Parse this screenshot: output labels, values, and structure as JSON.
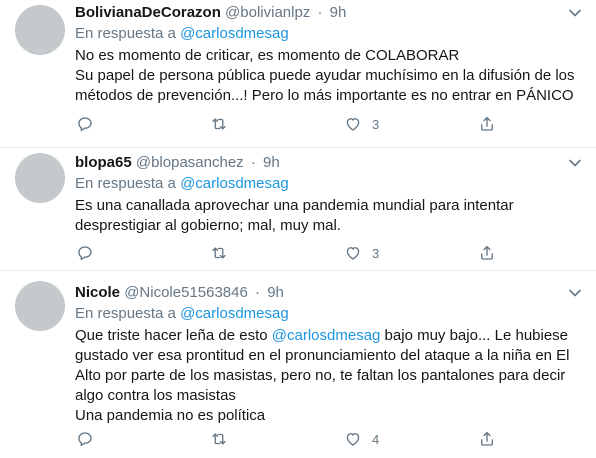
{
  "tweets": [
    {
      "name": "BolivianaDeCorazon",
      "handle": "@bolivianlpz",
      "dot": "·",
      "time": "9h",
      "reply_prefix": "En respuesta a",
      "reply_mention": "@carlosdmesag",
      "lines": [
        "No es momento de criticar, es momento de COLABORAR",
        "Su papel de persona pública puede ayudar muchísimo en la difusión de los",
        "métodos de prevención...! Pero lo más importante es no entrar en PÁNICO"
      ],
      "likes": "3"
    },
    {
      "name": "blopa65",
      "handle": "@blopasanchez",
      "dot": "·",
      "time": "9h",
      "reply_prefix": "En respuesta a",
      "reply_mention": "@carlosdmesag",
      "lines": [
        "Es una canallada aprovechar una pandemia mundial para intentar",
        "desprestigiar al gobierno; mal, muy mal."
      ],
      "likes": "3"
    },
    {
      "name": "Nicole",
      "handle": "@Nicole51563846",
      "dot": "·",
      "time": "9h",
      "reply_prefix": "En respuesta a",
      "reply_mention": "@carlosdmesag",
      "line1_before": "Que triste hacer leña de esto ",
      "line1_mention": "@carlosdmesag",
      "line1_after": " bajo muy bajo... Le hubiese",
      "lines": [
        "gustado ver esa prontitud en el pronunciamiento del ataque a la niña en El",
        "Alto por parte de los masistas, pero no, te faltan los pantalones para decir",
        "algo contra los masistas",
        "Una pandemia no es política"
      ],
      "likes": "4"
    }
  ],
  "icons": {
    "reply": "reply-icon",
    "retweet": "retweet-icon",
    "like": "heart-icon",
    "share": "share-icon",
    "more": "chevron-down-icon"
  },
  "colors": {
    "link": "#1b95e0",
    "muted": "#657786",
    "divider": "#e6ecf0"
  }
}
